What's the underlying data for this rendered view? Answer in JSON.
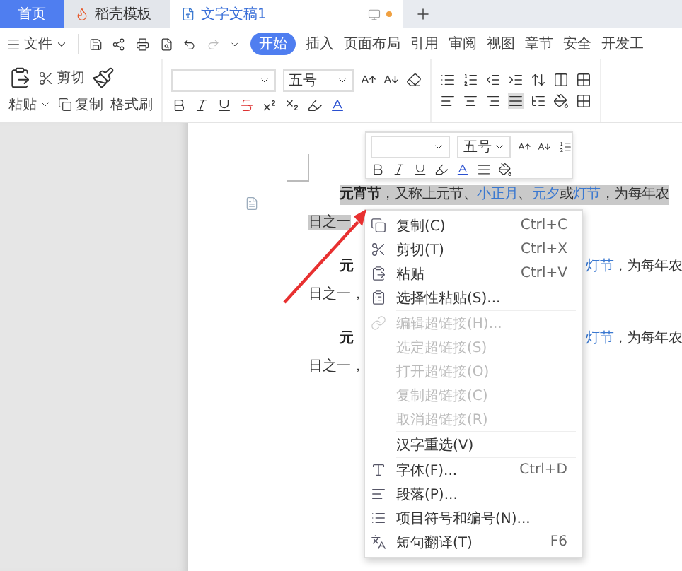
{
  "tabs": [
    {
      "label": "首页",
      "selected": false,
      "kind": "home"
    },
    {
      "label": "稻壳模板",
      "selected": false,
      "kind": "template"
    },
    {
      "label": "文字文稿1",
      "selected": true,
      "kind": "document"
    }
  ],
  "menu": {
    "file": "文件",
    "ribbon_tabs": [
      {
        "label": "开始",
        "selected": true
      },
      {
        "label": "插入",
        "selected": false
      },
      {
        "label": "页面布局",
        "selected": false
      },
      {
        "label": "引用",
        "selected": false
      },
      {
        "label": "审阅",
        "selected": false
      },
      {
        "label": "视图",
        "selected": false
      },
      {
        "label": "章节",
        "selected": false
      },
      {
        "label": "安全",
        "selected": false
      },
      {
        "label": "开发工",
        "selected": false
      }
    ]
  },
  "clipboard": {
    "paste": "粘贴",
    "cut": "剪切",
    "copy": "复制",
    "format_painter": "格式刷"
  },
  "font": {
    "size": "五号"
  },
  "mini_toolbar": {
    "size": "五号"
  },
  "paragraphs": [
    {
      "selected": true,
      "line1_left": [
        {
          "text": "元宵节",
          "kind": "bold"
        },
        {
          "text": "，又称上元节、",
          "kind": "plain"
        },
        {
          "text": "小正月",
          "kind": "link"
        },
        {
          "text": "、",
          "kind": "plain"
        },
        {
          "text": "元夕",
          "kind": "link"
        },
        {
          "text": "或",
          "kind": "plain"
        },
        {
          "text": "灯节",
          "kind": "link"
        },
        {
          "text": "，为每年农",
          "kind": "plain"
        }
      ],
      "line2": "日之一"
    },
    {
      "selected": false,
      "line1_left": [
        {
          "text": "元",
          "kind": "bold"
        }
      ],
      "line1_right": [
        {
          "text": "灯节",
          "kind": "link"
        },
        {
          "text": "，为每年农",
          "kind": "plain"
        }
      ],
      "line2": "日之一，"
    },
    {
      "selected": false,
      "line1_left": [
        {
          "text": "元",
          "kind": "bold"
        }
      ],
      "line1_right": [
        {
          "text": "灯节",
          "kind": "link"
        },
        {
          "text": "，为每年农",
          "kind": "plain"
        }
      ],
      "line2": "日之一，"
    }
  ],
  "context_menu": [
    {
      "kind": "item",
      "label": "复制(C)",
      "shortcut": "Ctrl+C",
      "disabled": false
    },
    {
      "kind": "item",
      "label": "剪切(T)",
      "shortcut": "Ctrl+X",
      "disabled": false
    },
    {
      "kind": "item",
      "label": "粘贴",
      "shortcut": "Ctrl+V",
      "disabled": false
    },
    {
      "kind": "item",
      "label": "选择性粘贴(S)...",
      "disabled": false
    },
    {
      "kind": "separator"
    },
    {
      "kind": "item",
      "label": "编辑超链接(H)...",
      "disabled": true
    },
    {
      "kind": "item",
      "label": "选定超链接(S)",
      "disabled": true
    },
    {
      "kind": "item",
      "label": "打开超链接(O)",
      "disabled": true
    },
    {
      "kind": "item",
      "label": "复制超链接(C)",
      "disabled": true
    },
    {
      "kind": "item",
      "label": "取消超链接(R)",
      "disabled": true
    },
    {
      "kind": "separator"
    },
    {
      "kind": "item",
      "label": "汉字重选(V)",
      "disabled": false
    },
    {
      "kind": "separator"
    },
    {
      "kind": "item",
      "label": "字体(F)...",
      "shortcut": "Ctrl+D",
      "disabled": false
    },
    {
      "kind": "item",
      "label": "段落(P)...",
      "disabled": false
    },
    {
      "kind": "item",
      "label": "项目符号和编号(N)...",
      "disabled": false
    },
    {
      "kind": "item",
      "label": "短句翻译(T)",
      "shortcut": "F6",
      "disabled": false
    }
  ]
}
